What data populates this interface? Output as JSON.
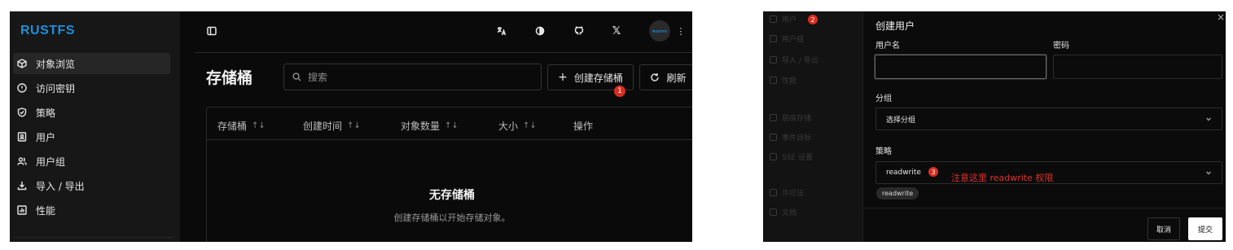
{
  "panel1": {
    "logo": "RUSTFS",
    "sidebar_items": [
      {
        "label": "对象浏览",
        "icon": "cube-icon",
        "active": true
      },
      {
        "label": "访问密钥",
        "icon": "key-circle-icon",
        "active": false
      },
      {
        "label": "策略",
        "icon": "shield-icon",
        "active": false
      },
      {
        "label": "用户",
        "icon": "user-card-icon",
        "active": false
      },
      {
        "label": "用户组",
        "icon": "users-icon",
        "active": false
      },
      {
        "label": "导入 / 导出",
        "icon": "download-icon",
        "active": false
      },
      {
        "label": "性能",
        "icon": "chart-icon",
        "active": false
      }
    ],
    "avatar_label": "RUSTFS",
    "page_title": "存储桶",
    "search_placeholder": "搜索",
    "create_button": "创建存储桶",
    "refresh_button": "刷新",
    "create_badge": "1",
    "table_headers": [
      {
        "label": "存储桶",
        "sortable": true
      },
      {
        "label": "创建时间",
        "sortable": true
      },
      {
        "label": "对象数量",
        "sortable": true
      },
      {
        "label": "大小",
        "sortable": true
      },
      {
        "label": "操作",
        "sortable": false
      }
    ],
    "sort_glyph": "↑↓",
    "empty_title": "无存储桶",
    "empty_subtitle": "创建存储桶以开始存储对象。"
  },
  "panel2": {
    "sidebar_items": [
      {
        "label": "用户",
        "badge": "2"
      },
      {
        "label": "用户组"
      },
      {
        "label": "导入 / 导出"
      },
      {
        "label": "性能"
      },
      {
        "label": "层级存储"
      },
      {
        "label": "事件目标"
      },
      {
        "label": "SSE 设置"
      },
      {
        "label": "许可证"
      },
      {
        "label": "文档"
      }
    ],
    "dialog_title": "创建用户",
    "username_label": "用户名",
    "password_label": "密码",
    "group_label": "分组",
    "group_placeholder": "选择分组",
    "policy_label": "策略",
    "policy_value": "readwrite",
    "policy_badge": "3",
    "annotation": "注意这里 readwrite 权限",
    "policy_tag": "readwrite",
    "cancel_button": "取消",
    "submit_button": "提交",
    "close_glyph": "×"
  },
  "colors": {
    "accent_blue": "#1d8fdc",
    "annotation_red": "#e0312a",
    "badge_red": "#d92d20"
  }
}
